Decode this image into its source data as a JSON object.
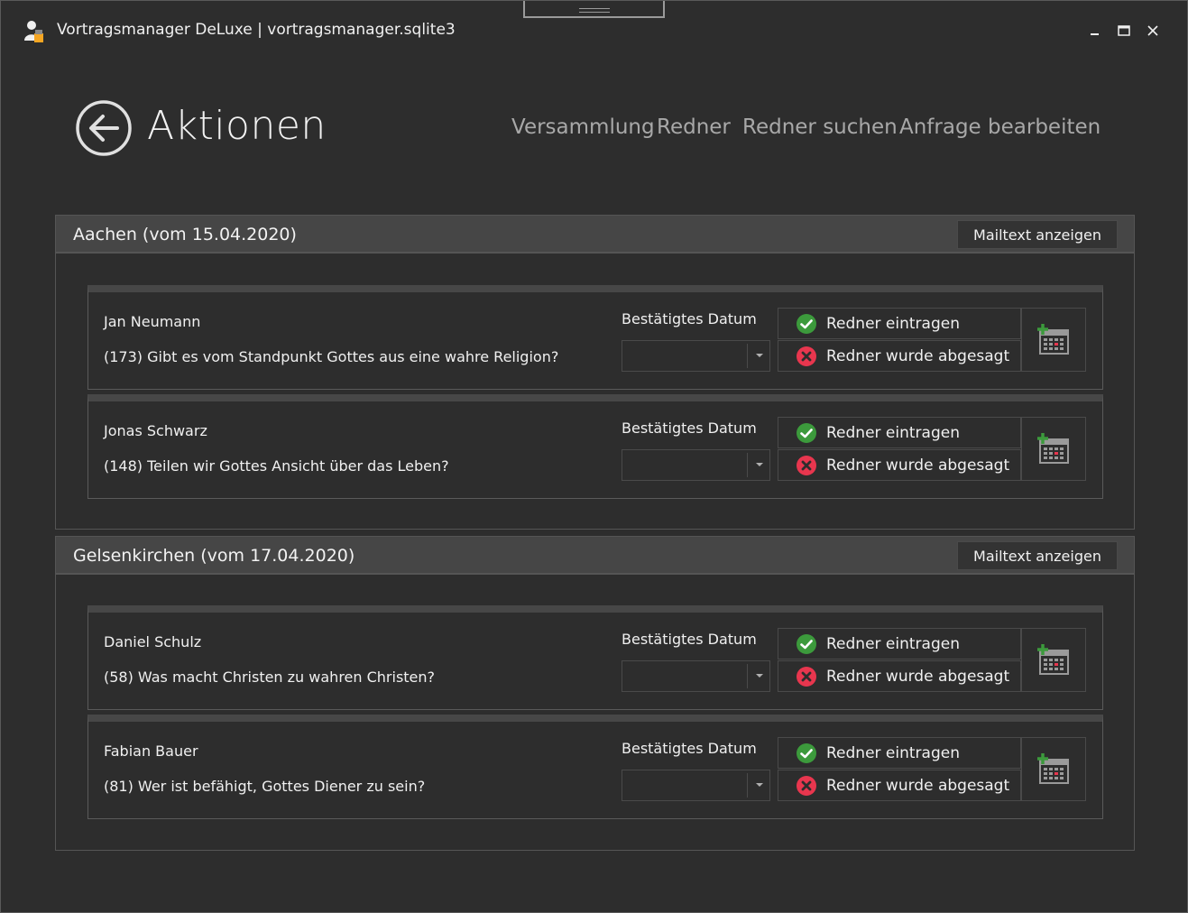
{
  "window": {
    "title": "Vortragsmanager DeLuxe | vortragsmanager.sqlite3",
    "minimize": "▁",
    "maximize": "☐",
    "close": "✕"
  },
  "page": {
    "title": "Aktionen",
    "nav": [
      "Versammlung",
      "Redner",
      "Redner suchen",
      "Anfrage bearbeiten"
    ]
  },
  "labels": {
    "date_label": "Bestätigtes Datum",
    "confirm": "Redner eintragen",
    "cancel": "Redner wurde abgesagt",
    "mailtext": "Mailtext anzeigen"
  },
  "groups": [
    {
      "title": "Aachen (vom 15.04.2020)",
      "entries": [
        {
          "speaker": "Jan Neumann",
          "talk": "(173) Gibt es vom Standpunkt Gottes aus eine wahre Religion?",
          "date": ""
        },
        {
          "speaker": "Jonas Schwarz",
          "talk": "(148) Teilen wir Gottes Ansicht über das Leben?",
          "date": ""
        }
      ]
    },
    {
      "title": "Gelsenkirchen (vom 17.04.2020)",
      "entries": [
        {
          "speaker": "Daniel Schulz",
          "talk": "(58) Was macht Christen zu wahren Christen?",
          "date": ""
        },
        {
          "speaker": "Fabian Bauer",
          "talk": "(81) Wer ist befähigt, Gottes Diener zu sein?",
          "date": ""
        }
      ]
    }
  ],
  "colors": {
    "background": "#2d2d2d",
    "header": "#464646",
    "success": "#3c9a3c",
    "danger": "#e8364e",
    "nav_text": "#a8a8a8"
  },
  "icons": {
    "back": "arrow-left-circle-icon",
    "confirm": "check-circle-icon",
    "cancel": "x-circle-icon",
    "calendar": "calendar-add-icon"
  }
}
